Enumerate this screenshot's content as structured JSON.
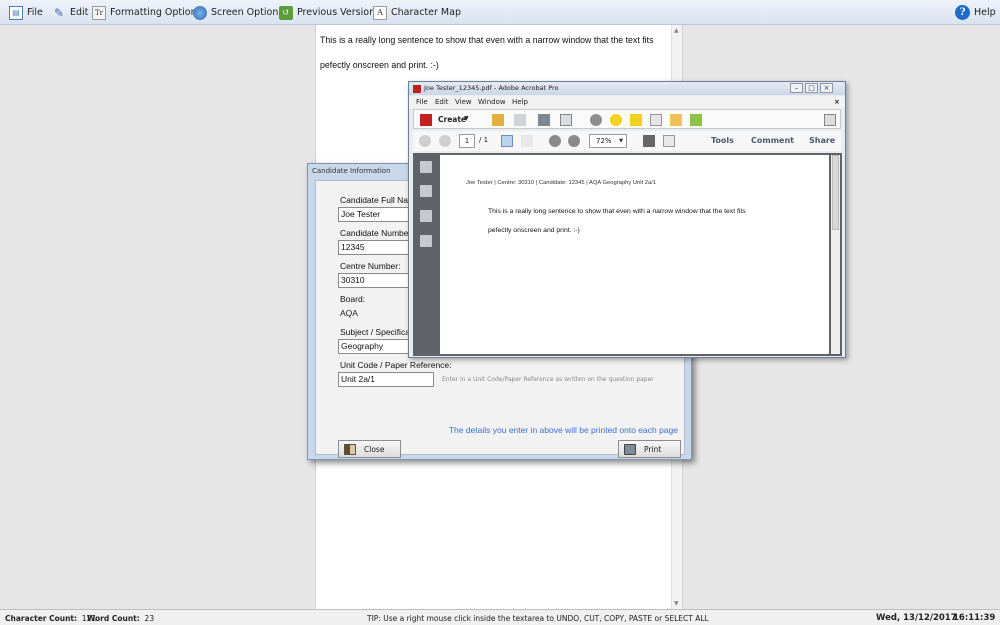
{
  "menu": {
    "file": "File",
    "edit": "Edit",
    "formatting": "Formatting Options",
    "screen": "Screen Options",
    "previous": "Previous Versions",
    "charmap": "Character Map",
    "help": "Help",
    "formatting_icon_glyph": "Tr",
    "charmap_icon_glyph": "A"
  },
  "editor": {
    "line1": "This is a really long sentence to show that even with a narrow window that the text fits",
    "line2": "pefectly onscreen and print. :-)"
  },
  "status": {
    "char_label": "Character Count:",
    "char_value": "121",
    "word_label": "Word Count:",
    "word_value": "23",
    "tip": "TIP: Use a right mouse click inside the textarea to UNDO, CUT, COPY, PASTE or SELECT ALL",
    "date": "Wed, 13/12/2017",
    "time": "16:11:39"
  },
  "dialog": {
    "title": "Candidate Information",
    "name_label": "Candidate Full Name:",
    "name_value": "Joe Tester",
    "number_label": "Candidate Number:",
    "number_value": "12345",
    "centre_label": "Centre Number:",
    "centre_value": "30310",
    "board_label": "Board:",
    "board_value": "AQA",
    "subject_label": "Subject / Specification:",
    "subject_value": "Geography",
    "unit_label": "Unit Code / Paper Reference:",
    "unit_value": "Unit 2a/1",
    "unit_hint": "Enter in a Unit Code/Paper Reference as written on the question paper",
    "note": "The details you enter in above will be printed onto each page",
    "close": "Close",
    "print": "Print"
  },
  "acrobat": {
    "title": "Joe Tester_12345.pdf - Adobe Acrobat Pro",
    "menu": [
      "File",
      "Edit",
      "View",
      "Window",
      "Help"
    ],
    "create": "Create",
    "page_current": "1",
    "page_total": "/ 1",
    "zoom": "72%",
    "tools": "Tools",
    "comment": "Comment",
    "share": "Share",
    "pdf_header": "Joe Tester | Centre: 30310 | Candidate: 12345 | AQA Geography Unit 2a/1",
    "pdf_line1": "This is a really long sentence to show that even with a narrow window that the text fits",
    "pdf_line2": "pefectly onscreen and print. :-)"
  },
  "colors": {
    "accent_blue": "#3b6fd6",
    "dialog_frame": "#c8d7ea",
    "acrobat_sidebar": "#5f6368",
    "pdf_icon_red": "#c0201e"
  }
}
